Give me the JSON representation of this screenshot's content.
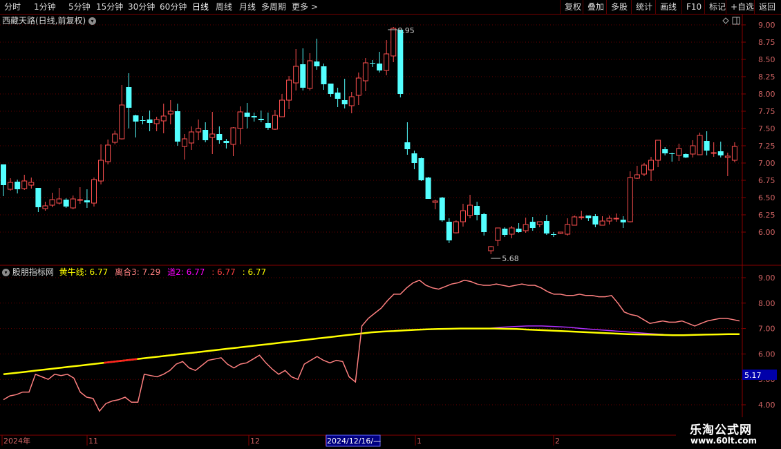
{
  "toolbar": {
    "left_items": [
      "分时",
      "1分钟",
      "5分钟",
      "15分钟",
      "30分钟",
      "60分钟",
      "日线",
      "周线",
      "月线",
      "多周期",
      "更多 >"
    ],
    "active": "日线",
    "right_items": [
      "复权",
      "叠加",
      "多股",
      "统计",
      "画线",
      "F10",
      "标记",
      "+自选",
      "返回"
    ]
  },
  "main_panel": {
    "title": "西藏天路(日线,前复权)",
    "high_label": "8.95",
    "low_label": "5.68",
    "y_ticks": [
      "9.00",
      "8.75",
      "8.50",
      "8.25",
      "8.00",
      "7.75",
      "7.50",
      "7.25",
      "7.00",
      "6.75",
      "6.50",
      "6.25",
      "6.00"
    ],
    "candles": [
      [
        6.98,
        6.68,
        6.98,
        6.52
      ],
      [
        6.62,
        6.72,
        6.78,
        6.6
      ],
      [
        6.73,
        6.62,
        6.76,
        6.56
      ],
      [
        6.63,
        6.74,
        6.83,
        6.61
      ],
      [
        6.68,
        6.72,
        6.79,
        6.63
      ],
      [
        6.64,
        6.36,
        6.64,
        6.29
      ],
      [
        6.34,
        6.38,
        6.44,
        6.31
      ],
      [
        6.39,
        6.47,
        6.57,
        6.36
      ],
      [
        6.42,
        6.48,
        6.64,
        6.4
      ],
      [
        6.47,
        6.37,
        6.49,
        6.35
      ],
      [
        6.35,
        6.48,
        6.53,
        6.33
      ],
      [
        6.46,
        6.47,
        6.65,
        6.41
      ],
      [
        6.46,
        6.43,
        6.62,
        6.35
      ],
      [
        6.42,
        6.76,
        6.79,
        6.37
      ],
      [
        6.74,
        7.04,
        7.27,
        6.69
      ],
      [
        7.02,
        7.26,
        7.34,
        6.98
      ],
      [
        7.3,
        7.42,
        7.47,
        7.27
      ],
      [
        7.35,
        7.84,
        8.13,
        7.34
      ],
      [
        8.1,
        7.8,
        8.3,
        7.5
      ],
      [
        7.69,
        7.6,
        7.7,
        7.37
      ],
      [
        7.62,
        7.61,
        7.68,
        7.56
      ],
      [
        7.63,
        7.58,
        7.76,
        7.46
      ],
      [
        7.57,
        7.63,
        7.67,
        7.46
      ],
      [
        7.61,
        7.68,
        7.86,
        7.43
      ],
      [
        7.71,
        7.75,
        7.91,
        7.56
      ],
      [
        7.75,
        7.31,
        7.86,
        7.25
      ],
      [
        7.24,
        7.35,
        7.42,
        7.05
      ],
      [
        7.29,
        7.45,
        7.53,
        7.19
      ],
      [
        7.45,
        7.5,
        7.63,
        7.33
      ],
      [
        7.48,
        7.33,
        7.59,
        7.3
      ],
      [
        7.37,
        7.42,
        7.74,
        7.13
      ],
      [
        7.42,
        7.33,
        7.53,
        7.28
      ],
      [
        7.32,
        7.29,
        7.35,
        7.21
      ],
      [
        7.27,
        7.51,
        7.52,
        7.1
      ],
      [
        7.5,
        7.74,
        7.82,
        7.27
      ],
      [
        7.73,
        7.67,
        7.87,
        7.5
      ],
      [
        7.68,
        7.66,
        7.73,
        7.6
      ],
      [
        7.64,
        7.62,
        7.76,
        7.59
      ],
      [
        7.58,
        7.51,
        7.73,
        7.48
      ],
      [
        7.49,
        7.69,
        7.77,
        7.48
      ],
      [
        7.67,
        7.91,
        8.0,
        7.68
      ],
      [
        7.91,
        8.2,
        8.26,
        7.78
      ],
      [
        8.16,
        8.4,
        8.65,
        8.05
      ],
      [
        8.43,
        8.09,
        8.66,
        8.05
      ],
      [
        8.08,
        8.48,
        8.59,
        8.05
      ],
      [
        8.47,
        8.4,
        8.8,
        8.35
      ],
      [
        8.4,
        8.14,
        8.44,
        8.06
      ],
      [
        8.15,
        8.0,
        8.14,
        7.96
      ],
      [
        8.02,
        7.93,
        8.09,
        7.81
      ],
      [
        7.91,
        7.85,
        8.22,
        7.79
      ],
      [
        7.83,
        7.96,
        8.03,
        7.72
      ],
      [
        7.98,
        8.23,
        8.31,
        7.84
      ],
      [
        8.19,
        8.45,
        8.52,
        8.04
      ],
      [
        8.45,
        8.44,
        8.49,
        8.39
      ],
      [
        8.44,
        8.34,
        8.61,
        8.31
      ],
      [
        8.34,
        8.58,
        8.78,
        8.27
      ],
      [
        8.55,
        8.95,
        8.97,
        8.46
      ],
      [
        8.93,
        8.0,
        8.93,
        7.95
      ],
      [
        7.3,
        7.2,
        7.59,
        7.12
      ],
      [
        7.14,
        7.0,
        7.18,
        6.91
      ],
      [
        7.07,
        6.75,
        7.08,
        6.74
      ],
      [
        6.79,
        6.48,
        6.8,
        6.48
      ],
      [
        6.43,
        6.45,
        6.47,
        6.33
      ],
      [
        6.5,
        6.17,
        6.51,
        6.15
      ],
      [
        6.15,
        5.88,
        6.2,
        5.84
      ],
      [
        5.99,
        6.15,
        6.17,
        5.98
      ],
      [
        6.15,
        6.31,
        6.41,
        6.08
      ],
      [
        6.24,
        6.39,
        6.54,
        6.2
      ],
      [
        6.38,
        6.25,
        6.44,
        6.17
      ],
      [
        6.26,
        6.0,
        6.28,
        5.95
      ],
      [
        5.73,
        5.79,
        5.8,
        5.68
      ],
      [
        5.88,
        6.06,
        6.06,
        5.8
      ],
      [
        6.05,
        5.96,
        6.07,
        5.93
      ],
      [
        5.97,
        6.06,
        6.09,
        5.91
      ],
      [
        6.05,
        6.0,
        6.13,
        5.99
      ],
      [
        6.02,
        6.11,
        6.21,
        5.99
      ],
      [
        6.15,
        6.06,
        6.22,
        6.02
      ],
      [
        6.11,
        6.15,
        6.15,
        6.07
      ],
      [
        6.16,
        5.98,
        6.25,
        5.96
      ],
      [
        5.97,
        5.96,
        6.0,
        5.93
      ],
      [
        5.98,
        6.0,
        6.0,
        5.97
      ],
      [
        5.97,
        6.11,
        6.2,
        5.95
      ],
      [
        6.1,
        6.22,
        6.24,
        6.1
      ],
      [
        6.22,
        6.22,
        6.31,
        6.18
      ],
      [
        6.24,
        6.2,
        6.24,
        6.16
      ],
      [
        6.23,
        6.11,
        6.26,
        6.07
      ],
      [
        6.1,
        6.16,
        6.23,
        6.1
      ],
      [
        6.16,
        6.2,
        6.24,
        6.11
      ],
      [
        6.2,
        6.2,
        6.27,
        6.15
      ],
      [
        6.18,
        6.14,
        6.23,
        6.06
      ],
      [
        6.15,
        6.79,
        6.88,
        6.14
      ],
      [
        6.78,
        6.83,
        6.96,
        6.77
      ],
      [
        6.84,
        6.97,
        7.0,
        6.81
      ],
      [
        6.9,
        7.04,
        7.09,
        6.74
      ],
      [
        7.04,
        7.33,
        7.33,
        6.94
      ],
      [
        7.2,
        7.14,
        7.23,
        7.11
      ],
      [
        7.14,
        7.13,
        7.15,
        7.02
      ],
      [
        7.11,
        7.21,
        7.28,
        7.03
      ],
      [
        7.13,
        7.08,
        7.14,
        7.07
      ],
      [
        7.13,
        7.25,
        7.33,
        7.08
      ],
      [
        7.12,
        7.4,
        7.44,
        7.12
      ],
      [
        7.32,
        7.18,
        7.46,
        7.11
      ],
      [
        7.14,
        7.15,
        7.3,
        7.09
      ],
      [
        7.17,
        7.11,
        7.31,
        7.08
      ],
      [
        7.08,
        7.1,
        7.15,
        6.81
      ],
      [
        7.04,
        7.24,
        7.3,
        7.01
      ]
    ]
  },
  "sub_panel": {
    "title": "股朋指标网",
    "legend": [
      {
        "label": "黄牛线",
        "value": "6.77",
        "color": "#ffff00"
      },
      {
        "label": "离合3",
        "value": "7.29",
        "color": "#ff8080"
      },
      {
        "label": "道2",
        "value": "6.77",
        "color": "#ff00ff"
      },
      {
        "label": "",
        "value": "6.77",
        "color": "#ff4040"
      },
      {
        "label": "",
        "value": "6.77",
        "color": "#ffff00"
      }
    ],
    "y_ticks": [
      "9.00",
      "8.00",
      "7.00",
      "6.00",
      "5.00",
      "4.00"
    ],
    "price_tag": "5.17",
    "pink_line": [
      4.2,
      4.35,
      4.4,
      4.5,
      4.5,
      5.2,
      5.1,
      5.0,
      5.2,
      5.15,
      5.2,
      5.05,
      4.5,
      4.3,
      4.25,
      3.75,
      4.05,
      4.15,
      4.2,
      4.3,
      4.1,
      4.1,
      5.2,
      5.15,
      5.1,
      5.2,
      5.35,
      5.6,
      5.7,
      5.45,
      5.35,
      5.55,
      5.75,
      5.8,
      5.85,
      5.6,
      5.45,
      5.6,
      5.65,
      5.8,
      5.95,
      5.65,
      5.4,
      5.2,
      5.35,
      5.1,
      5.0,
      5.6,
      5.75,
      5.9,
      5.75,
      5.65,
      5.75,
      5.7,
      5.1,
      4.9,
      7.1,
      7.4,
      7.6,
      7.8,
      8.1,
      8.35,
      8.35,
      8.6,
      8.8,
      8.9,
      8.7,
      8.6,
      8.55,
      8.65,
      8.75,
      8.8,
      8.9,
      8.85,
      8.75,
      8.7,
      8.7,
      8.75,
      8.7,
      8.65,
      8.7,
      8.75,
      8.7,
      8.7,
      8.6,
      8.45,
      8.35,
      8.35,
      8.3,
      8.3,
      8.35,
      8.3,
      8.3,
      8.25,
      8.25,
      8.3,
      8.0,
      7.65,
      7.55,
      7.5,
      7.35,
      7.2,
      7.25,
      7.3,
      7.25,
      7.25,
      7.3,
      7.2,
      7.1,
      7.2,
      7.3,
      7.35,
      7.4,
      7.4,
      7.35,
      7.3
    ],
    "yellow_line": [
      5.2,
      5.25,
      5.3,
      5.35,
      5.4,
      5.45,
      5.5,
      5.55,
      5.6,
      5.65,
      5.7,
      5.75,
      5.8,
      5.85,
      5.9,
      5.95,
      6.0,
      6.05,
      6.1,
      6.15,
      6.2,
      6.25,
      6.3,
      6.35,
      6.4,
      6.45,
      6.5,
      6.55,
      6.6,
      6.65,
      6.7,
      6.75,
      6.8,
      6.85,
      6.88,
      6.9,
      6.93,
      6.95,
      6.97,
      6.98,
      6.99,
      7.0,
      7.0,
      7.0,
      7.0,
      6.99,
      6.98,
      6.96,
      6.94,
      6.92,
      6.9,
      6.88,
      6.86,
      6.84,
      6.82,
      6.8,
      6.78,
      6.77,
      6.76,
      6.75,
      6.74,
      6.74,
      6.75,
      6.76,
      6.77,
      6.78,
      6.78
    ],
    "purple_line": [
      7.0,
      7.05,
      7.08,
      7.1,
      7.1,
      7.08,
      7.05,
      7.0,
      6.96,
      6.92,
      6.88,
      6.84,
      6.8,
      6.77
    ]
  },
  "x_axis": {
    "labels": [
      "2024年",
      "11",
      "12",
      "2024/12/16/—",
      "1",
      "2"
    ],
    "highlight": "2024/12/16/—"
  },
  "watermark": {
    "line1": "乐淘公式网",
    "line2": "www.60lt.com"
  }
}
